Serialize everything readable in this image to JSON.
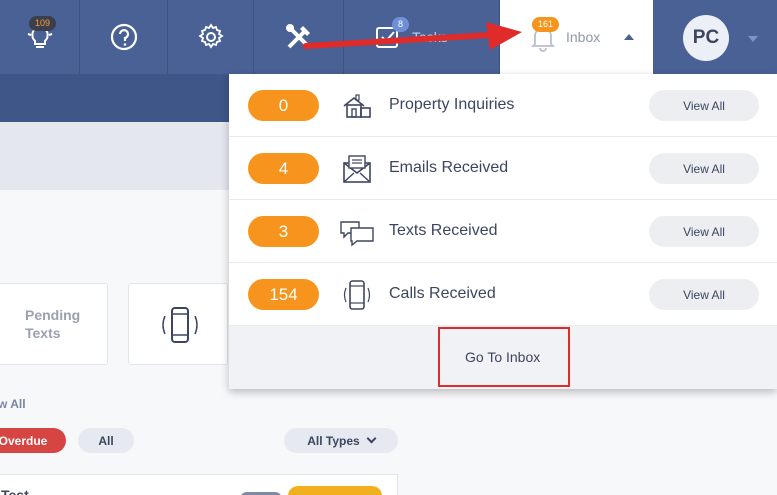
{
  "nav": {
    "ideas_badge": "109",
    "tasks_badge": "8",
    "tasks_label": "Tasks",
    "inbox_badge": "161",
    "inbox_label": "Inbox",
    "avatar_initials": "PC"
  },
  "background": {
    "pending_texts_label": "Pending Texts",
    "view_all_link": "iew All",
    "overdue_label": "Overdue",
    "all_label": "All",
    "all_types_label": "All Types",
    "bottom_text": "Test"
  },
  "inbox_dropdown": {
    "rows": [
      {
        "count": "0",
        "label": "Property Inquiries",
        "icon": "house-icon",
        "button": "View All"
      },
      {
        "count": "4",
        "label": "Emails Received",
        "icon": "envelope-icon",
        "button": "View All"
      },
      {
        "count": "3",
        "label": "Texts Received",
        "icon": "chat-bubbles-icon",
        "button": "View All"
      },
      {
        "count": "154",
        "label": "Calls Received",
        "icon": "mobile-phone-icon",
        "button": "View All"
      }
    ],
    "footer_link": "Go To Inbox"
  },
  "colors": {
    "nav_bg": "#4a6195",
    "badge_orange": "#f7941d",
    "annotation_red": "#e02b2b"
  }
}
